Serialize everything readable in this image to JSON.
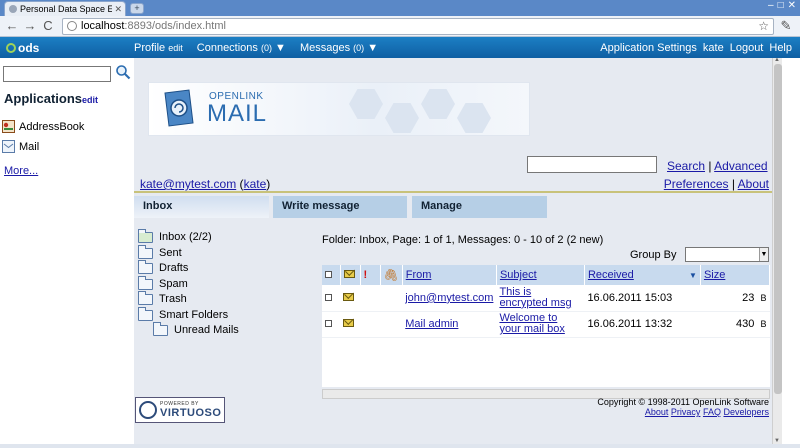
{
  "browser": {
    "tab_title": "Personal Data Space Exp",
    "url_host": "localhost",
    "url_path": ":8893/ods/index.html",
    "new_tab": "+",
    "back": "←",
    "forward": "→",
    "reload": "C",
    "star": "☆",
    "wrench": "✎",
    "minimize": "–",
    "maximize": "□",
    "close": "✕"
  },
  "ods": {
    "logo": "ods",
    "profile": "Profile",
    "profile_edit": "edit",
    "connections": "Connections",
    "connections_count": "(0)",
    "messages": "Messages",
    "messages_count": "(0)",
    "app_settings": "Application Settings",
    "user": "kate",
    "logout": "Logout",
    "help": "Help"
  },
  "sidebar": {
    "title": "Applications",
    "edit": "edit",
    "apps": [
      {
        "label": "AddressBook",
        "icon": "addressbook-icon"
      },
      {
        "label": "Mail",
        "icon": "mail-icon"
      }
    ],
    "more": "More..."
  },
  "banner": {
    "brand_top": "OPENLINK",
    "brand_name": "MAIL"
  },
  "search": {
    "value": "",
    "search_link": "Search",
    "sep": "|",
    "advanced_link": "Advanced"
  },
  "user_line": {
    "email": "kate@mytest.com",
    "name": "kate",
    "preferences": "Preferences",
    "sep": "|",
    "about": "About"
  },
  "tabs": [
    "Inbox",
    "Write message",
    "Manage"
  ],
  "folders": [
    {
      "label": "Inbox",
      "count": "(2/2)"
    },
    {
      "label": "Sent",
      "count": ""
    },
    {
      "label": "Drafts",
      "count": ""
    },
    {
      "label": "Spam",
      "count": ""
    },
    {
      "label": "Trash",
      "count": ""
    },
    {
      "label": "Smart Folders",
      "count": ""
    },
    {
      "label": "Unread Mails",
      "count": ""
    }
  ],
  "messages_panel": {
    "folder_info": "Folder: Inbox, Page: 1 of 1,  Messages: 0 - 10 of 2 (2 new)",
    "group_by": "Group By",
    "group_by_value": "",
    "columns": {
      "from": "From",
      "subject": "Subject",
      "received": "Received",
      "size": "Size",
      "sort_arrow": "▼",
      "priority": "!",
      "attach": "🖇"
    },
    "rows": [
      {
        "from": "john@mytest.com",
        "subject": "This is encrypted msg",
        "received": "16.06.2011 15:03",
        "size": "23",
        "unit": "B"
      },
      {
        "from": "Mail admin",
        "subject": "Welcome to your mail box",
        "received": "16.06.2011 13:32",
        "size": "430",
        "unit": "B"
      }
    ]
  },
  "footer": {
    "powered_by": "POWERED BY",
    "virtuoso": "VIRTUOSO",
    "copyright": "Copyright © 1998-2011 OpenLink Software",
    "links": [
      "About",
      "Privacy",
      "FAQ",
      "Developers"
    ]
  },
  "colors": {
    "ods_bar": "#1c7fc4",
    "tab_bar": "#5a88c7",
    "main_bg": "#e6eaf1",
    "link": "#1a1aa6",
    "table_header": "#c8daee"
  }
}
